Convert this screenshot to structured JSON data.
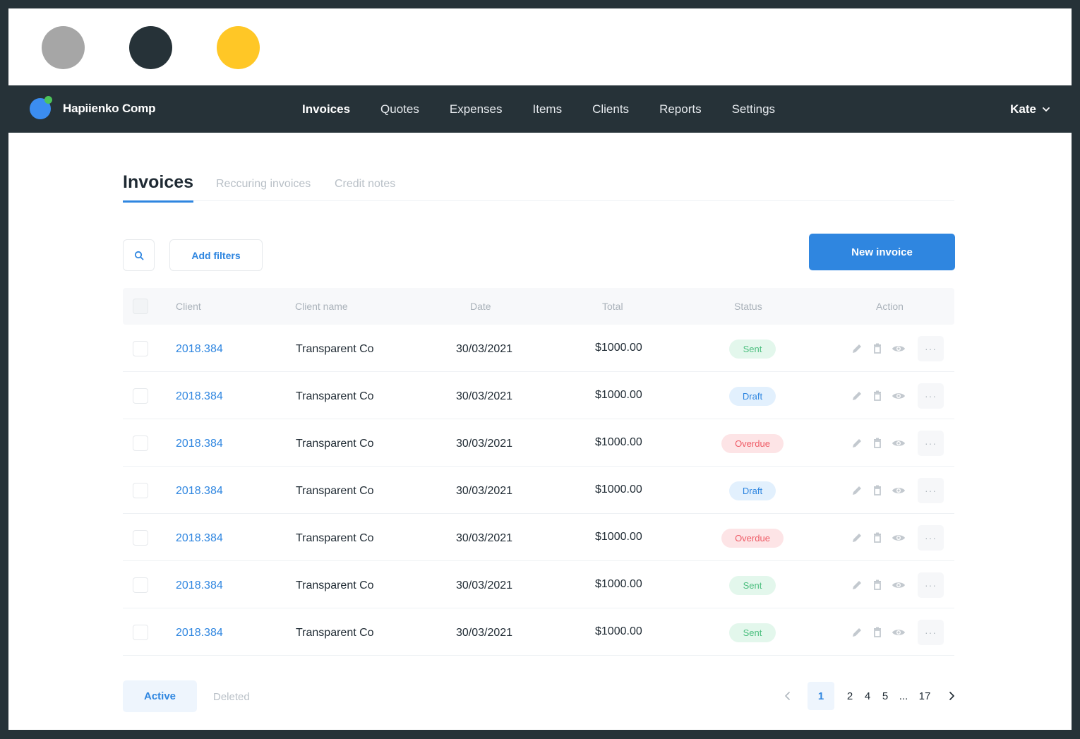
{
  "palette": {
    "colors": [
      "#a6a6a6",
      "#263238",
      "#ffc726"
    ]
  },
  "navbar": {
    "brand": "Hapiienko Comp",
    "items": [
      {
        "label": "Invoices",
        "active": true
      },
      {
        "label": "Quotes",
        "active": false
      },
      {
        "label": "Expenses",
        "active": false
      },
      {
        "label": "Items",
        "active": false
      },
      {
        "label": "Clients",
        "active": false
      },
      {
        "label": "Reports",
        "active": false
      },
      {
        "label": "Settings",
        "active": false
      }
    ],
    "user": "Kate"
  },
  "page": {
    "tabs": [
      "Invoices",
      "Reccuring invoices",
      "Credit notes"
    ],
    "add_filters": "Add filters",
    "new_invoice": "New invoice"
  },
  "table": {
    "headers": [
      "Client",
      "Client name",
      "Date",
      "Total",
      "Status",
      "Action"
    ],
    "rows": [
      {
        "client": "2018.384",
        "name": "Transparent Co",
        "date": "30/03/2021",
        "total": "$1000.00",
        "status": "Sent",
        "kind": "sent"
      },
      {
        "client": "2018.384",
        "name": "Transparent Co",
        "date": "30/03/2021",
        "total": "$1000.00",
        "status": "Draft",
        "kind": "draft"
      },
      {
        "client": "2018.384",
        "name": "Transparent Co",
        "date": "30/03/2021",
        "total": "$1000.00",
        "status": "Overdue",
        "kind": "overdue"
      },
      {
        "client": "2018.384",
        "name": "Transparent Co",
        "date": "30/03/2021",
        "total": "$1000.00",
        "status": "Draft",
        "kind": "draft"
      },
      {
        "client": "2018.384",
        "name": "Transparent Co",
        "date": "30/03/2021",
        "total": "$1000.00",
        "status": "Overdue",
        "kind": "overdue"
      },
      {
        "client": "2018.384",
        "name": "Transparent Co",
        "date": "30/03/2021",
        "total": "$1000.00",
        "status": "Sent",
        "kind": "sent"
      },
      {
        "client": "2018.384",
        "name": "Transparent Co",
        "date": "30/03/2021",
        "total": "$1000.00",
        "status": "Sent",
        "kind": "sent"
      }
    ],
    "more_label": "···"
  },
  "footer": {
    "tabs": [
      "Active",
      "Deleted"
    ],
    "pages": [
      "1",
      "2",
      "4",
      "5",
      "...",
      "17"
    ],
    "current_page": "1"
  },
  "icons": {
    "search": "search-icon",
    "edit": "pencil-icon",
    "delete": "trash-icon",
    "view": "eye-icon",
    "prev": "chevron-left-icon",
    "next": "chevron-right-icon",
    "user_menu": "chevron-down-icon"
  }
}
